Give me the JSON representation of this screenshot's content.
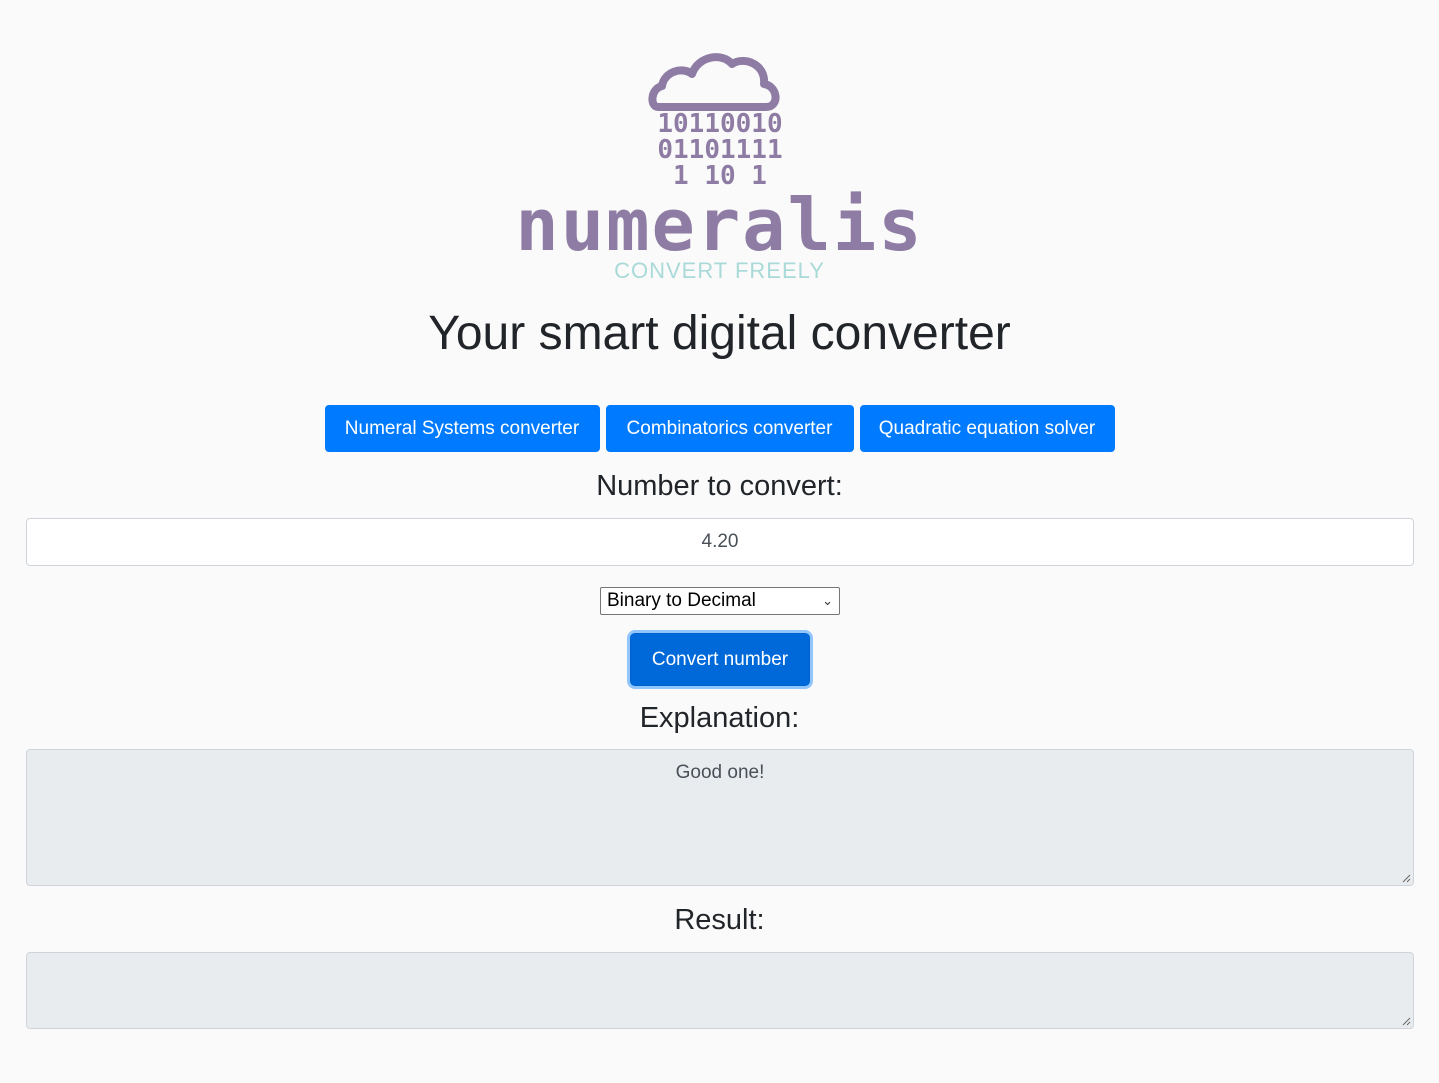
{
  "logo": {
    "binary_rows": [
      "10110010",
      "01101111",
      "1 10 1"
    ],
    "wordmark": "numeralis",
    "tagline": "CONVERT FREELY"
  },
  "headline": "Your smart digital converter",
  "nav": {
    "numeral_systems": "Numeral Systems converter",
    "combinatorics": "Combinatorics converter",
    "quadratic": "Quadratic equation solver"
  },
  "form": {
    "number_label": "Number to convert:",
    "number_value": "4.20",
    "select_value": "Binary to Decimal",
    "convert_label": "Convert number",
    "explanation_label": "Explanation:",
    "explanation_value": "Good one!",
    "result_label": "Result:",
    "result_value": ""
  },
  "colors": {
    "primary": "#007bff",
    "logo_purple": "#8e7ca4",
    "tagline_teal": "#a9dad8",
    "readonly_bg": "#e9ecef"
  }
}
